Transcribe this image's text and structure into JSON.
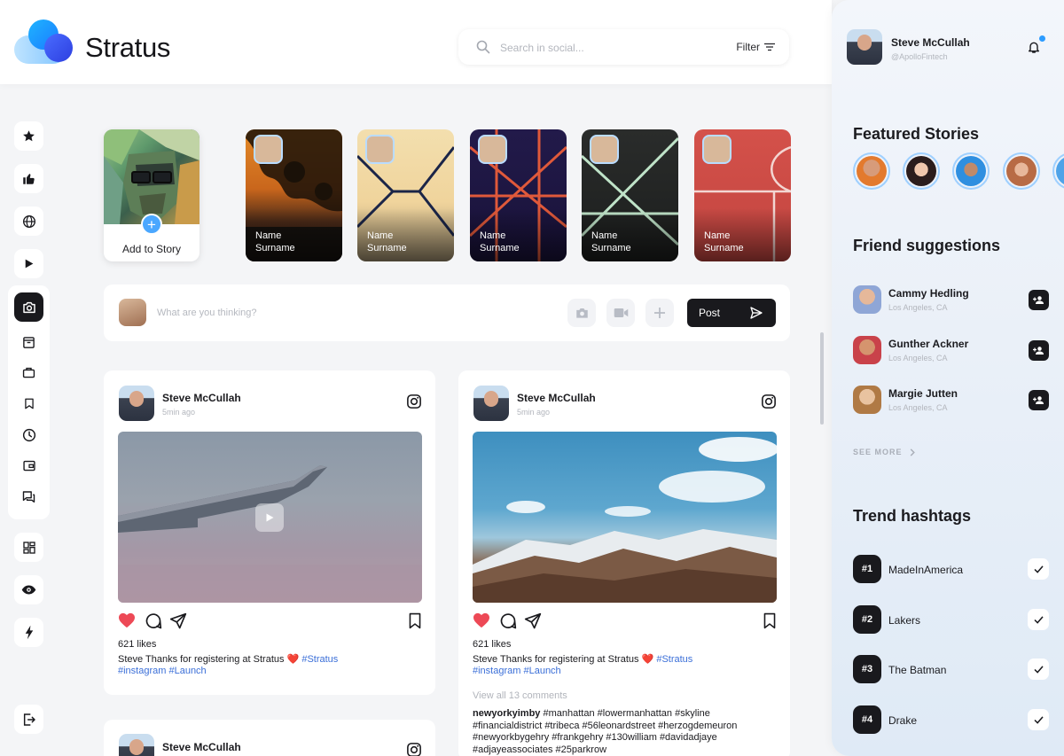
{
  "app": {
    "name": "Stratus",
    "brand_colors": {
      "accent": "#2C9CFF",
      "dark": "#19191D",
      "tag": "#3B6FD8"
    }
  },
  "search": {
    "placeholder": "Search in social...",
    "filter_label": "Filter"
  },
  "sidebar": {
    "items": [
      {
        "name": "star-icon"
      },
      {
        "name": "thumbs-up-icon"
      },
      {
        "name": "globe-icon"
      },
      {
        "name": "play-icon"
      },
      {
        "name": "camera-icon",
        "active": true
      },
      {
        "name": "archive-icon"
      },
      {
        "name": "briefcase-icon"
      },
      {
        "name": "bookmark-icon"
      },
      {
        "name": "clock-icon"
      },
      {
        "name": "wallet-icon"
      },
      {
        "name": "chat-icon"
      },
      {
        "name": "dashboard-icon"
      },
      {
        "name": "eye-icon"
      },
      {
        "name": "bolt-icon"
      },
      {
        "name": "logout-icon"
      }
    ]
  },
  "stories": {
    "add_label": "Add to Story",
    "items": [
      {
        "name": "Name",
        "surname": "Surname"
      },
      {
        "name": "Name",
        "surname": "Surname"
      },
      {
        "name": "Name",
        "surname": "Surname"
      },
      {
        "name": "Name",
        "surname": "Surname"
      },
      {
        "name": "Name",
        "surname": "Surname"
      }
    ]
  },
  "composer": {
    "placeholder": "What are you thinking?",
    "post_label": "Post"
  },
  "posts": [
    {
      "author": "Steve McCullah",
      "time": "5min ago",
      "likes": "621 likes",
      "caption_author": "Steve",
      "caption_text": " Thanks for registering at Stratus ❤️ ",
      "caption_tags": "#Stratus",
      "caption_tags_line2": "#instagram #Launch"
    },
    {
      "author": "Steve McCullah",
      "time": "5min ago",
      "likes": "621 likes",
      "caption_author": "Steve",
      "caption_text": " Thanks for registering at Stratus ❤️ ",
      "caption_tags": "#Stratus",
      "caption_tags_line2": "#instagram #Launch",
      "comments": "View all 13 comments",
      "comment_author": "newyorkyimby",
      "comment_text": " #manhattan #lowermanhattan #skyline #financialdistrict #tribeca #56leonardstreet #herzogdemeuron #newyorkbygehry #frankgehry #130william #davidadjaye #adjayeassociates #25parkrow"
    },
    {
      "author": "Steve McCullah"
    }
  ],
  "right_panel": {
    "user": {
      "name": "Steve McCullah",
      "handle": "@ApolloFintech"
    },
    "featured_title": "Featured Stories",
    "suggestions_title": "Friend suggestions",
    "suggestions": [
      {
        "name": "Cammy Hedling",
        "location": "Los Angeles, CA"
      },
      {
        "name": "Gunther Ackner",
        "location": "Los Angeles, CA"
      },
      {
        "name": "Margie Jutten",
        "location": "Los Angeles, CA"
      }
    ],
    "see_more": "SEE MORE",
    "hashtags_title": "Trend hashtags",
    "hashtags": [
      {
        "rank": "#1",
        "name": "MadeInAmerica"
      },
      {
        "rank": "#2",
        "name": "Lakers"
      },
      {
        "rank": "#3",
        "name": "The Batman"
      },
      {
        "rank": "#4",
        "name": "Drake"
      }
    ]
  }
}
